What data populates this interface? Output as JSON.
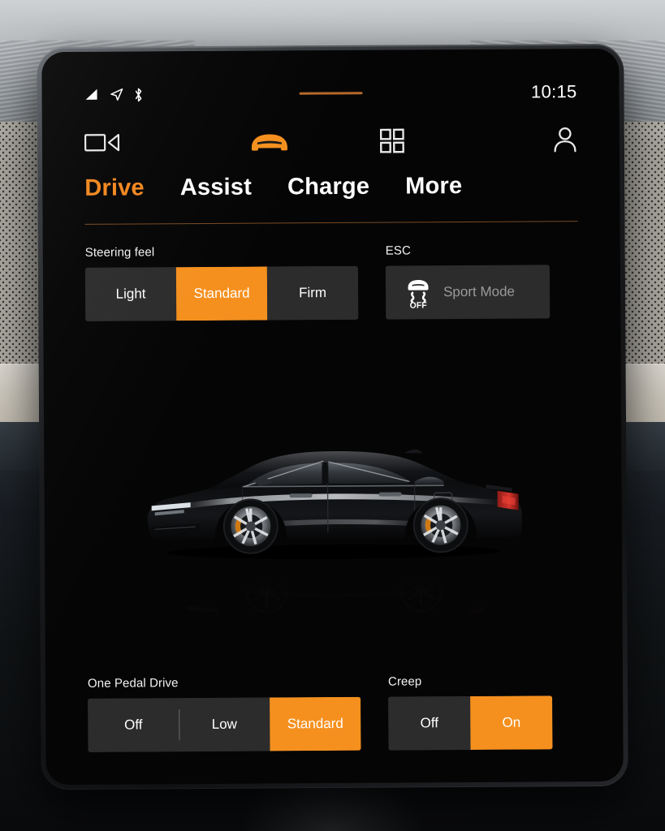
{
  "theme": {
    "accent": "#f5901e",
    "accent_text": "#f2871e",
    "tile_bg": "#2c2c2c",
    "screen_bg": "#050505",
    "text": "#ffffff",
    "muted_text": "#9a9a9a",
    "handle": "#b5692a"
  },
  "status_bar": {
    "icons": [
      "signal-bars-icon",
      "location-arrow-icon",
      "bluetooth-icon"
    ],
    "pull_handle": "pull-down-handle",
    "clock": "10:15"
  },
  "app_rail": {
    "items": [
      {
        "name": "media-camera-icon",
        "label": "Media",
        "active": false
      },
      {
        "name": "car-front-icon",
        "label": "Car",
        "active": true
      },
      {
        "name": "app-grid-icon",
        "label": "Apps",
        "active": false
      },
      {
        "name": "profile-person-icon",
        "label": "Profile",
        "active": false
      }
    ]
  },
  "tabs": [
    {
      "label": "Drive",
      "active": true
    },
    {
      "label": "Assist",
      "active": false
    },
    {
      "label": "Charge",
      "active": false
    },
    {
      "label": "More",
      "active": false
    }
  ],
  "controls_top": {
    "steering_feel": {
      "label": "Steering feel",
      "options": [
        "Light",
        "Standard",
        "Firm"
      ],
      "selected": "Standard"
    },
    "esc": {
      "label": "ESC",
      "icon": "esc-off-icon",
      "icon_text": "OFF",
      "button_label": "Sport Mode",
      "enabled": false
    }
  },
  "vehicle_image": {
    "name": "polestar-2-side-profile",
    "body_color": "#0b0b0d",
    "caliper_color": "#d07a14",
    "has_reflection": true
  },
  "controls_bottom": {
    "one_pedal_drive": {
      "label": "One Pedal Drive",
      "options": [
        "Off",
        "Low",
        "Standard"
      ],
      "selected": "Standard"
    },
    "creep": {
      "label": "Creep",
      "options": [
        "Off",
        "On"
      ],
      "selected": "On"
    }
  }
}
